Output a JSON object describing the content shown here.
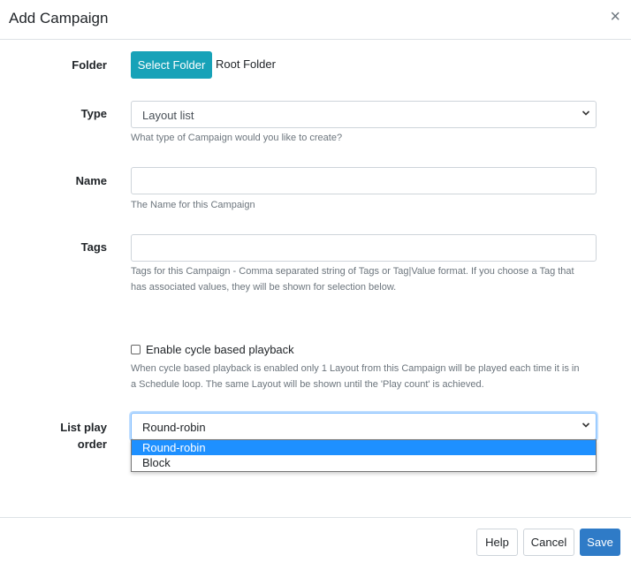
{
  "dialog": {
    "title": "Add Campaign",
    "close_label": "×"
  },
  "fields": {
    "folder": {
      "label": "Folder",
      "button_label": "Select Folder",
      "current": "Root Folder"
    },
    "type": {
      "label": "Type",
      "selected": "Layout list",
      "help": "What type of Campaign would you like to create?"
    },
    "name": {
      "label": "Name",
      "value": "",
      "help": "The Name for this Campaign"
    },
    "tags": {
      "label": "Tags",
      "value": "",
      "help_line1": "Tags for this Campaign - Comma separated string of Tags or Tag|Value format. If you choose a Tag that",
      "help_line2": "has associated values, they will be shown for selection below."
    },
    "cycle": {
      "label": "Enable cycle based playback",
      "checked": false,
      "help_line1": "When cycle based playback is enabled only 1 Layout from this Campaign will be played each time it is in",
      "help_line2": "a Schedule loop. The same Layout will be shown until the 'Play count' is achieved."
    },
    "play_order": {
      "label_line1": "List play",
      "label_line2": "order",
      "selected": "Round-robin",
      "options": [
        "Round-robin",
        "Block"
      ]
    }
  },
  "footer": {
    "help_label": "Help",
    "cancel_label": "Cancel",
    "save_label": "Save"
  },
  "colors": {
    "folder_button": "#17a2b8",
    "save_button": "#2f7bc7",
    "option_highlight": "#1e90ff"
  }
}
